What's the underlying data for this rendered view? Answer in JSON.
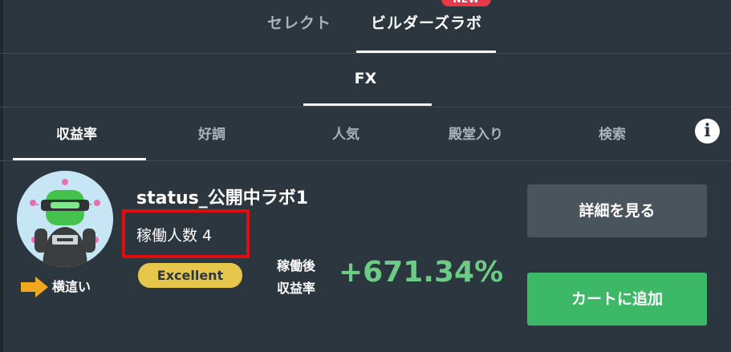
{
  "top_tabs": {
    "select": "セレクト",
    "builders": "ビルダーズラボ",
    "new_badge": "NEW"
  },
  "market": "FX",
  "category_tabs": [
    "収益率",
    "好調",
    "人気",
    "殿堂入り",
    "検索"
  ],
  "info_icon": "i",
  "lab": {
    "name": "status_公開中ラボ1",
    "operators": "稼働人数 4",
    "rating": "Excellent",
    "trend": "横這い",
    "return_label_line1": "稼働後",
    "return_label_line2": "収益率",
    "return_value": "+671.34%"
  },
  "buttons": {
    "detail": "詳細を見る",
    "cart": "カートに追加"
  },
  "icons": {
    "avatar": "robot-avatar",
    "trend": "arrow-right-icon",
    "info": "info-icon"
  },
  "colors": {
    "background": "#2c363e",
    "accent_green": "#3cb867",
    "return_green": "#6ccb85",
    "rating_yellow": "#e6c74c",
    "new_red": "#e6394a",
    "highlight_red": "#e00d0d"
  }
}
